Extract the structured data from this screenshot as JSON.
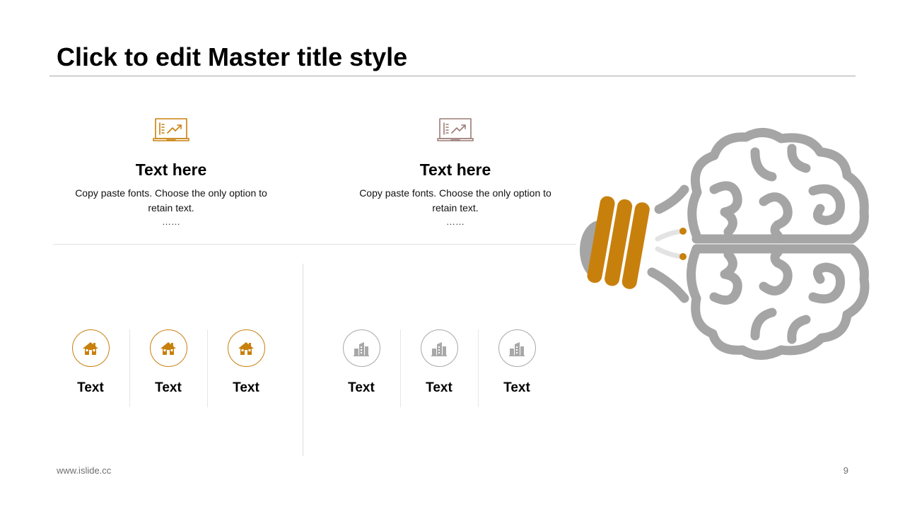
{
  "slide": {
    "title": "Click to edit Master title style",
    "footer_left": "www.islide.cc",
    "page_number": "9"
  },
  "cards": [
    {
      "icon": "laptop-chart-icon",
      "heading": "Text here",
      "desc_line1": "Copy paste fonts. Choose the only option to",
      "desc_line2": "retain text.",
      "dots": "……",
      "color": "#c8800d"
    },
    {
      "icon": "laptop-chart-icon",
      "heading": "Text here",
      "desc_line1": "Copy paste fonts. Choose the only option to",
      "desc_line2": "retain text.",
      "dots": "……",
      "color": "#9c7b76"
    }
  ],
  "items_left": [
    {
      "icon": "house-icon",
      "label": "Text"
    },
    {
      "icon": "house-icon",
      "label": "Text"
    },
    {
      "icon": "house-icon",
      "label": "Text"
    }
  ],
  "items_right": [
    {
      "icon": "buildings-icon",
      "label": "Text"
    },
    {
      "icon": "buildings-icon",
      "label": "Text"
    },
    {
      "icon": "buildings-icon",
      "label": "Text"
    }
  ],
  "colors": {
    "accent": "#c8800d",
    "gray": "#a8a8a8",
    "brain": "#a5a5a5"
  },
  "illustration": {
    "icon": "brain-lightbulb-icon"
  }
}
